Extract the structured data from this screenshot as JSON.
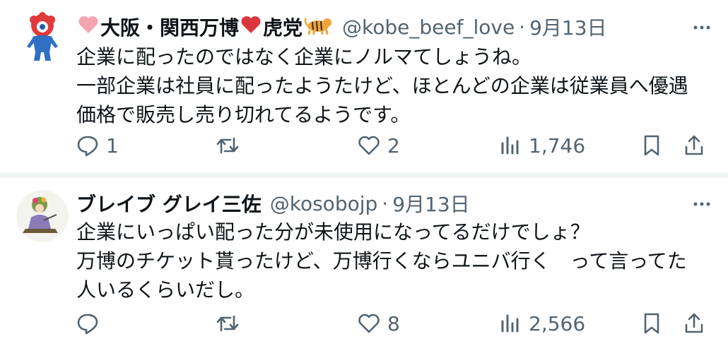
{
  "tweets": [
    {
      "display_name": "大阪・関西万博",
      "display_name_suffix": "虎党",
      "name_emojis": [
        "pink-heart",
        "red-heart",
        "tiger"
      ],
      "handle": "@kobe_beef_love",
      "separator": "·",
      "date": "9月13日",
      "text": "企業に配ったのではなく企業にノルマてしょうね。\n一部企業は社員に配ったようたけど、ほとんどの企業は従業員へ優遇\n価格で販売し売り切れてるようです。",
      "replies": "1",
      "retweets": "",
      "likes": "2",
      "views": "1,746"
    },
    {
      "display_name": "ブレイブ グレイ三佐",
      "handle": "@kosobojp",
      "separator": "·",
      "date": "9月13日",
      "text": "企業にいっぱい配った分が未使用になってるだけでしょ？\n万博のチケット貰ったけど、万博行くならユニバ行く　って言ってた\n人いるくらいだし。",
      "replies": "",
      "retweets": "",
      "likes": "8",
      "views": "2,566"
    }
  ],
  "colors": {
    "text": "#0f1419",
    "secondary": "#536471",
    "divider": "#eff3f4",
    "heart_pink": "#f4a3b0",
    "heart_red": "#d9363e"
  }
}
